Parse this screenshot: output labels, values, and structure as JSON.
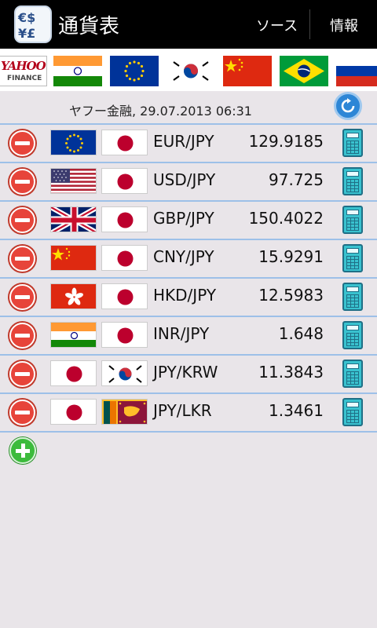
{
  "actionbar": {
    "title": "通貨表",
    "sources_label": "ソース",
    "info_label": "情報",
    "app_icon": "currency-app-icon"
  },
  "flag_strip": {
    "provider_logo": {
      "line1": "YAHOO!",
      "line2": "FINANCE"
    },
    "flags": [
      "india",
      "eu",
      "south-korea",
      "china",
      "brazil",
      "russia"
    ]
  },
  "source_line": "ヤフー金融, 29.07.2013 06:31",
  "rates": [
    {
      "pair": "EUR/JPY",
      "rate": "129.9185",
      "flags": [
        "eu",
        "japan"
      ]
    },
    {
      "pair": "USD/JPY",
      "rate": "97.725",
      "flags": [
        "usa",
        "japan"
      ]
    },
    {
      "pair": "GBP/JPY",
      "rate": "150.4022",
      "flags": [
        "uk",
        "japan"
      ]
    },
    {
      "pair": "CNY/JPY",
      "rate": "15.9291",
      "flags": [
        "china",
        "japan"
      ]
    },
    {
      "pair": "HKD/JPY",
      "rate": "12.5983",
      "flags": [
        "hong-kong",
        "japan"
      ]
    },
    {
      "pair": "INR/JPY",
      "rate": "1.648",
      "flags": [
        "india",
        "japan"
      ]
    },
    {
      "pair": "JPY/KRW",
      "rate": "11.3843",
      "flags": [
        "japan",
        "south-korea"
      ]
    },
    {
      "pair": "JPY/LKR",
      "rate": "1.3461",
      "flags": [
        "japan",
        "sri-lanka"
      ]
    }
  ],
  "colors": {
    "actionbar_bg": "#000000",
    "background": "#e9e5e9",
    "separator": "#9dc0e8",
    "delete": "#e7443a",
    "add": "#3cbb3c",
    "refresh": "#2d86d6",
    "calculator": "#39c2cf"
  }
}
